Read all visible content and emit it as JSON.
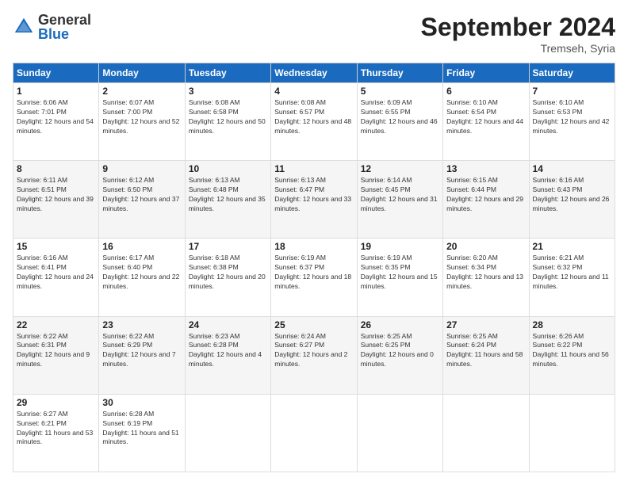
{
  "logo": {
    "general": "General",
    "blue": "Blue"
  },
  "title": "September 2024",
  "location": "Tremseh, Syria",
  "weekdays": [
    "Sunday",
    "Monday",
    "Tuesday",
    "Wednesday",
    "Thursday",
    "Friday",
    "Saturday"
  ],
  "weeks": [
    [
      {
        "day": 1,
        "sunrise": "6:06 AM",
        "sunset": "7:01 PM",
        "daylight": "12 hours and 54 minutes."
      },
      {
        "day": 2,
        "sunrise": "6:07 AM",
        "sunset": "7:00 PM",
        "daylight": "12 hours and 52 minutes."
      },
      {
        "day": 3,
        "sunrise": "6:08 AM",
        "sunset": "6:58 PM",
        "daylight": "12 hours and 50 minutes."
      },
      {
        "day": 4,
        "sunrise": "6:08 AM",
        "sunset": "6:57 PM",
        "daylight": "12 hours and 48 minutes."
      },
      {
        "day": 5,
        "sunrise": "6:09 AM",
        "sunset": "6:55 PM",
        "daylight": "12 hours and 46 minutes."
      },
      {
        "day": 6,
        "sunrise": "6:10 AM",
        "sunset": "6:54 PM",
        "daylight": "12 hours and 44 minutes."
      },
      {
        "day": 7,
        "sunrise": "6:10 AM",
        "sunset": "6:53 PM",
        "daylight": "12 hours and 42 minutes."
      }
    ],
    [
      {
        "day": 8,
        "sunrise": "6:11 AM",
        "sunset": "6:51 PM",
        "daylight": "12 hours and 39 minutes."
      },
      {
        "day": 9,
        "sunrise": "6:12 AM",
        "sunset": "6:50 PM",
        "daylight": "12 hours and 37 minutes."
      },
      {
        "day": 10,
        "sunrise": "6:13 AM",
        "sunset": "6:48 PM",
        "daylight": "12 hours and 35 minutes."
      },
      {
        "day": 11,
        "sunrise": "6:13 AM",
        "sunset": "6:47 PM",
        "daylight": "12 hours and 33 minutes."
      },
      {
        "day": 12,
        "sunrise": "6:14 AM",
        "sunset": "6:45 PM",
        "daylight": "12 hours and 31 minutes."
      },
      {
        "day": 13,
        "sunrise": "6:15 AM",
        "sunset": "6:44 PM",
        "daylight": "12 hours and 29 minutes."
      },
      {
        "day": 14,
        "sunrise": "6:16 AM",
        "sunset": "6:43 PM",
        "daylight": "12 hours and 26 minutes."
      }
    ],
    [
      {
        "day": 15,
        "sunrise": "6:16 AM",
        "sunset": "6:41 PM",
        "daylight": "12 hours and 24 minutes."
      },
      {
        "day": 16,
        "sunrise": "6:17 AM",
        "sunset": "6:40 PM",
        "daylight": "12 hours and 22 minutes."
      },
      {
        "day": 17,
        "sunrise": "6:18 AM",
        "sunset": "6:38 PM",
        "daylight": "12 hours and 20 minutes."
      },
      {
        "day": 18,
        "sunrise": "6:19 AM",
        "sunset": "6:37 PM",
        "daylight": "12 hours and 18 minutes."
      },
      {
        "day": 19,
        "sunrise": "6:19 AM",
        "sunset": "6:35 PM",
        "daylight": "12 hours and 15 minutes."
      },
      {
        "day": 20,
        "sunrise": "6:20 AM",
        "sunset": "6:34 PM",
        "daylight": "12 hours and 13 minutes."
      },
      {
        "day": 21,
        "sunrise": "6:21 AM",
        "sunset": "6:32 PM",
        "daylight": "12 hours and 11 minutes."
      }
    ],
    [
      {
        "day": 22,
        "sunrise": "6:22 AM",
        "sunset": "6:31 PM",
        "daylight": "12 hours and 9 minutes."
      },
      {
        "day": 23,
        "sunrise": "6:22 AM",
        "sunset": "6:29 PM",
        "daylight": "12 hours and 7 minutes."
      },
      {
        "day": 24,
        "sunrise": "6:23 AM",
        "sunset": "6:28 PM",
        "daylight": "12 hours and 4 minutes."
      },
      {
        "day": 25,
        "sunrise": "6:24 AM",
        "sunset": "6:27 PM",
        "daylight": "12 hours and 2 minutes."
      },
      {
        "day": 26,
        "sunrise": "6:25 AM",
        "sunset": "6:25 PM",
        "daylight": "12 hours and 0 minutes."
      },
      {
        "day": 27,
        "sunrise": "6:25 AM",
        "sunset": "6:24 PM",
        "daylight": "11 hours and 58 minutes."
      },
      {
        "day": 28,
        "sunrise": "6:26 AM",
        "sunset": "6:22 PM",
        "daylight": "11 hours and 56 minutes."
      }
    ],
    [
      {
        "day": 29,
        "sunrise": "6:27 AM",
        "sunset": "6:21 PM",
        "daylight": "11 hours and 53 minutes."
      },
      {
        "day": 30,
        "sunrise": "6:28 AM",
        "sunset": "6:19 PM",
        "daylight": "11 hours and 51 minutes."
      },
      null,
      null,
      null,
      null,
      null
    ]
  ]
}
